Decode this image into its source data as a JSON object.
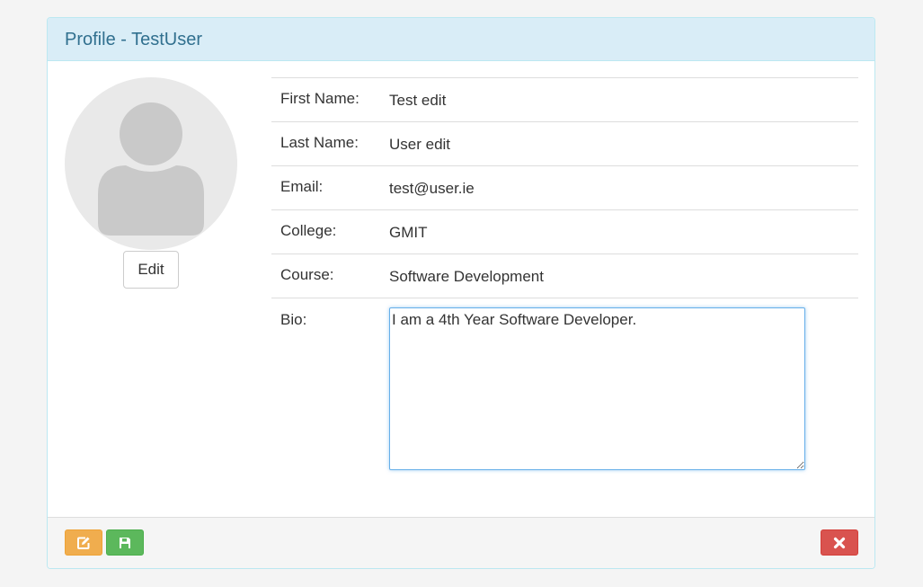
{
  "panel": {
    "title": "Profile - TestUser"
  },
  "avatar": {
    "icon": "user-silhouette-icon",
    "edit_label": "Edit"
  },
  "profile_fields": [
    {
      "label": "First Name:",
      "value": "Test edit"
    },
    {
      "label": "Last Name:",
      "value": "User edit"
    },
    {
      "label": "Email:",
      "value": "test@user.ie"
    },
    {
      "label": "College:",
      "value": "GMIT"
    },
    {
      "label": "Course:",
      "value": "Software Development"
    }
  ],
  "bio": {
    "label": "Bio:",
    "value": "I am a 4th Year Software Developer."
  },
  "footer": {
    "edit_icon": "edit-icon",
    "save_icon": "save-icon",
    "close_icon": "close-icon"
  },
  "colors": {
    "heading_bg": "#d9edf7",
    "heading_text": "#31708f",
    "warning": "#f0ad4e",
    "success": "#5cb85c",
    "danger": "#d9534f"
  }
}
